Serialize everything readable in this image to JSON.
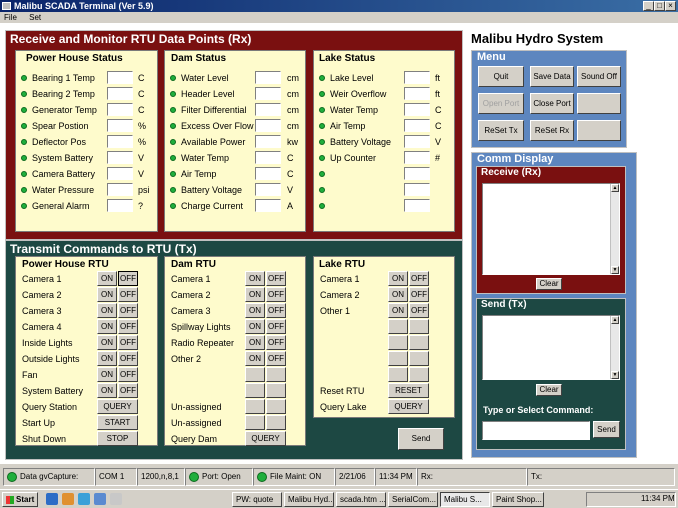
{
  "window": {
    "title": "Malibu SCADA Terminal (Ver 5.9)",
    "controls": [
      "_",
      "□",
      "×"
    ]
  },
  "menu": [
    "File",
    "Set"
  ],
  "rx": {
    "title": "Receive and Monitor RTU Data Points (Rx)",
    "groups": [
      {
        "title": "Power House Status",
        "points": [
          {
            "label": "Bearing 1 Temp",
            "unit": "C"
          },
          {
            "label": "Bearing 2 Temp",
            "unit": "C"
          },
          {
            "label": "Generator Temp",
            "unit": "C"
          },
          {
            "label": "Spear Postion",
            "unit": "%"
          },
          {
            "label": "Deflector Pos",
            "unit": "%"
          },
          {
            "label": "System Battery",
            "unit": "V"
          },
          {
            "label": "Camera Battery",
            "unit": "V"
          },
          {
            "label": "Water Pressure",
            "unit": "psi"
          },
          {
            "label": "General Alarm",
            "unit": "?"
          }
        ]
      },
      {
        "title": "Dam Status",
        "points": [
          {
            "label": "Water Level",
            "unit": "cm"
          },
          {
            "label": "Header Level",
            "unit": "cm"
          },
          {
            "label": "Filter Differential",
            "unit": "cm"
          },
          {
            "label": "Excess Over Flow",
            "unit": "cm"
          },
          {
            "label": "Available Power",
            "unit": "kw"
          },
          {
            "label": "Water Temp",
            "unit": "C"
          },
          {
            "label": "Air Temp",
            "unit": "C"
          },
          {
            "label": "Battery Voltage",
            "unit": "V"
          },
          {
            "label": "Charge Current",
            "unit": "A"
          }
        ]
      },
      {
        "title": "Lake Status",
        "points": [
          {
            "label": "Lake Level",
            "unit": "ft"
          },
          {
            "label": "Weir Overflow",
            "unit": "ft"
          },
          {
            "label": "Water Temp",
            "unit": "C"
          },
          {
            "label": "Air Temp",
            "unit": "C"
          },
          {
            "label": "Battery Voltage",
            "unit": "V"
          },
          {
            "label": "Up Counter",
            "unit": "#"
          },
          {
            "label": "",
            "unit": ""
          },
          {
            "label": "",
            "unit": ""
          },
          {
            "label": "",
            "unit": ""
          }
        ]
      }
    ]
  },
  "tx": {
    "title": "Transmit Commands to RTU (Tx)",
    "groups": [
      {
        "title": "Power House RTU",
        "rows": [
          {
            "label": "Camera 1",
            "type": "onoff"
          },
          {
            "label": "Camera 2",
            "type": "onoff"
          },
          {
            "label": "Camera 3",
            "type": "onoff"
          },
          {
            "label": "Camera 4",
            "type": "onoff"
          },
          {
            "label": "Inside Lights",
            "type": "onoff"
          },
          {
            "label": "Outside Lights",
            "type": "onoff"
          },
          {
            "label": "Fan",
            "type": "onoff"
          },
          {
            "label": "System Battery",
            "type": "onoff"
          },
          {
            "label": "Query Station",
            "type": "single",
            "btn": "QUERY"
          },
          {
            "label": "Start Up",
            "type": "single",
            "btn": "START"
          },
          {
            "label": "Shut Down",
            "type": "single",
            "btn": "STOP"
          }
        ]
      },
      {
        "title": "Dam RTU",
        "rows": [
          {
            "label": "Camera 1",
            "type": "onoff"
          },
          {
            "label": "Camera 2",
            "type": "onoff"
          },
          {
            "label": "Camera 3",
            "type": "onoff"
          },
          {
            "label": "Spillway Lights",
            "type": "onoff"
          },
          {
            "label": "Radio Repeater",
            "type": "onoff"
          },
          {
            "label": "Other 2",
            "type": "onoff"
          },
          {
            "label": "",
            "type": "blank"
          },
          {
            "label": "",
            "type": "blank"
          },
          {
            "label": "Un-assigned",
            "type": "blank"
          },
          {
            "label": "Un-assigned",
            "type": "blank"
          },
          {
            "label": "Query Dam",
            "type": "single",
            "btn": "QUERY"
          }
        ]
      },
      {
        "title": "Lake RTU",
        "rows": [
          {
            "label": "Camera 1",
            "type": "onoff"
          },
          {
            "label": "Camera 2",
            "type": "onoff"
          },
          {
            "label": "Other 1",
            "type": "onoff"
          },
          {
            "label": "",
            "type": "blank"
          },
          {
            "label": "",
            "type": "blank"
          },
          {
            "label": "",
            "type": "blank"
          },
          {
            "label": "",
            "type": "blank"
          },
          {
            "label": "Reset RTU",
            "type": "single",
            "btn": "RESET"
          },
          {
            "label": "Query Lake",
            "type": "single",
            "btn": "QUERY"
          }
        ]
      }
    ],
    "on": "ON",
    "off": "OFF",
    "send": "Send"
  },
  "system_title": "Malibu Hydro System",
  "menu_panel": {
    "title": "Menu",
    "buttons": [
      "Quit",
      "Save Data",
      "Sound Off",
      "Open Port",
      "Close Port",
      "",
      "ReSet Tx",
      "ReSet Rx",
      ""
    ]
  },
  "comm": {
    "title": "Comm Display",
    "receive_title": "Receive (Rx)",
    "send_title": "Send (Tx)",
    "clear": "Clear",
    "type_label": "Type or Select Command:",
    "send": "Send"
  },
  "status": {
    "data_capture": "Data gvCapture:",
    "com": "COM 1",
    "settings": "1200,n,8,1",
    "port": "Port: Open",
    "file_maint": "File Maint: ON",
    "date": "2/21/06",
    "time": "11:34 PM",
    "rx": "Rx:",
    "tx": "Tx:"
  },
  "taskbar": {
    "start": "Start",
    "tasks": [
      "PW: quote",
      "Malibu Hyd...",
      "scada.htm ...",
      "SerialCom...",
      "Malibu S...",
      "Paint Shop..."
    ],
    "clock": "11:34 PM"
  }
}
